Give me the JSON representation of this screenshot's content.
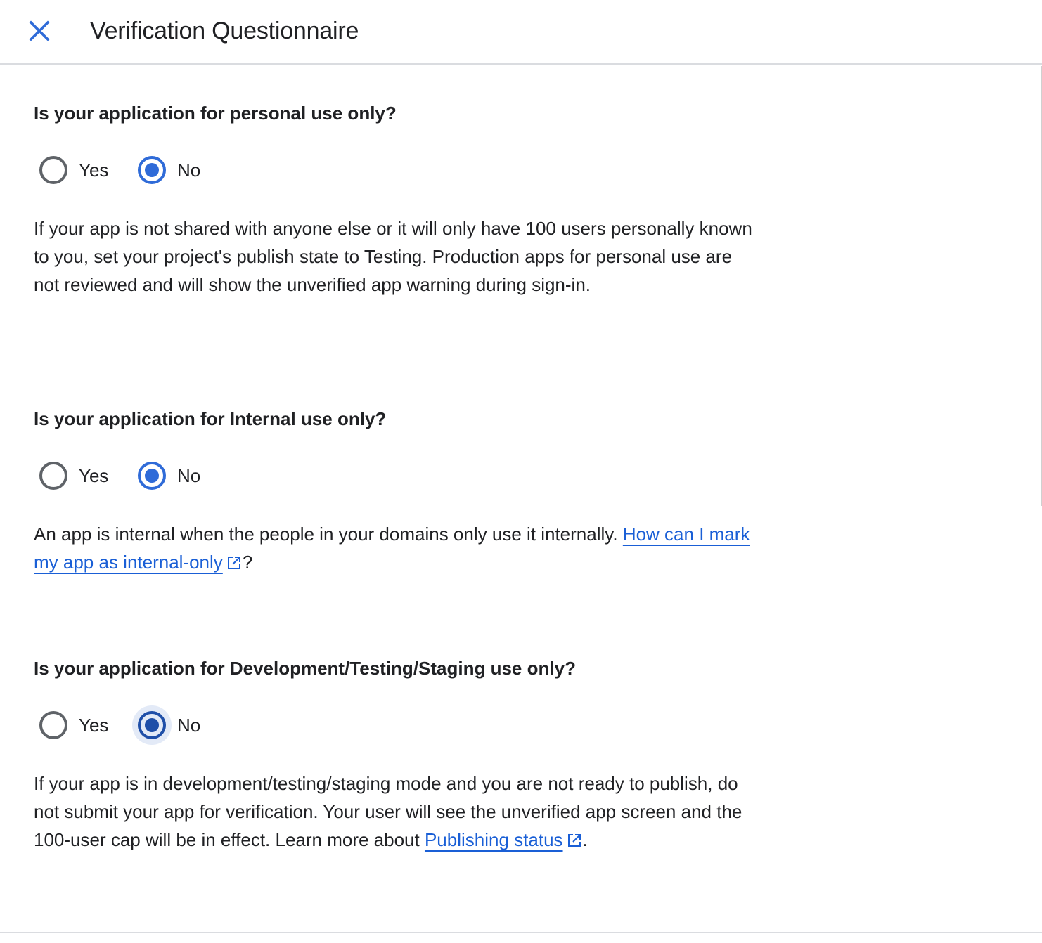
{
  "header": {
    "title": "Verification Questionnaire",
    "close_icon": "close-icon"
  },
  "colors": {
    "accent": "#2f6bd8",
    "link": "#1a5fd6",
    "text": "#202124",
    "divider": "#dadce0"
  },
  "questions": [
    {
      "question": "Is your application for personal use only?",
      "options": [
        {
          "label": "Yes",
          "selected": false
        },
        {
          "label": "No",
          "selected": true
        }
      ],
      "description": "If your app is not shared with anyone else or it will only have 100 users personally known to you, set your project's publish state to Testing. Production apps for personal use are not reviewed and will show the unverified app warning during sign-in."
    },
    {
      "question": "Is your application for Internal use only?",
      "options": [
        {
          "label": "Yes",
          "selected": false
        },
        {
          "label": "No",
          "selected": true
        }
      ],
      "description": "An app is internal when the people in your domains only use it internally.",
      "link_text": "How can I mark my app as internal-only",
      "after_link": "?"
    },
    {
      "question": "Is your application for Development/Testing/Staging use only?",
      "options": [
        {
          "label": "Yes",
          "selected": false
        },
        {
          "label": "No",
          "selected": true
        }
      ],
      "description": "If your app is in development/testing/staging mode and you are not ready to publish, do not submit your app for verification. Your user will see the unverified app screen and the 100-user cap will be in effect. Learn more about",
      "link_text": "Publishing status",
      "after_link": "."
    }
  ]
}
